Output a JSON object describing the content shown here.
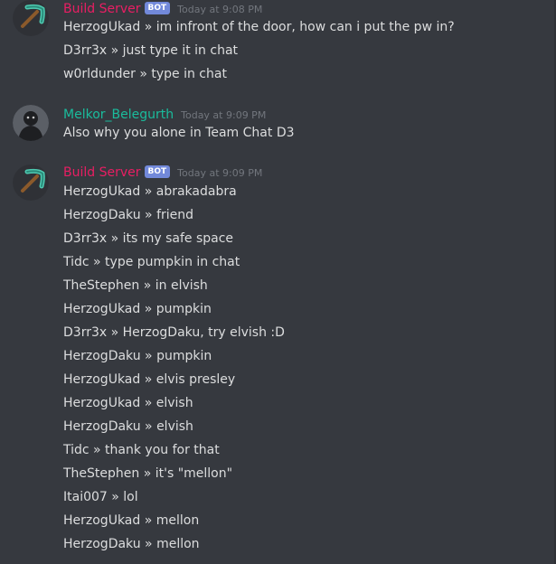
{
  "colors": {
    "background": "#36393f",
    "bot_name": "#e91e63",
    "user_name": "#1abc9c",
    "bot_tag": "#7289da",
    "timestamp": "#72767d",
    "message": "#dcddde"
  },
  "groups": [
    {
      "author": "Build Server",
      "bot_tag": "BOT",
      "timestamp": "Today at 9:08 PM",
      "avatar_icon": "pickaxe-icon",
      "lines": [
        "HerzogUkad »  im infront of the door, how can i put the pw in?",
        "D3rr3x »  just type it in chat",
        "w0rldunder »  type in chat"
      ]
    },
    {
      "author": "Melkor_Belegurth",
      "timestamp": "Today at 9:09 PM",
      "avatar_icon": "user-avatar-icon",
      "lines": [
        "Also why you alone in Team Chat D3"
      ]
    },
    {
      "author": "Build Server",
      "bot_tag": "BOT",
      "timestamp": "Today at 9:09 PM",
      "avatar_icon": "pickaxe-icon",
      "lines": [
        "HerzogUkad »  abrakadabra",
        "HerzogDaku »  friend",
        "D3rr3x »  its my safe space",
        "Tidc »  type pumpkin in chat",
        "TheStephen »  in elvish",
        "HerzogUkad »  pumpkin",
        "D3rr3x »  HerzogDaku, try elvish :D",
        "HerzogDaku »  pumpkin",
        "HerzogUkad »  elvis presley",
        "HerzogUkad »  elvish",
        "HerzogDaku »  elvish",
        "Tidc »  thank you for that",
        "TheStephen »  it's \"mellon\"",
        "Itai007 »  lol",
        "HerzogUkad »  mellon",
        "HerzogDaku »  mellon"
      ]
    }
  ]
}
